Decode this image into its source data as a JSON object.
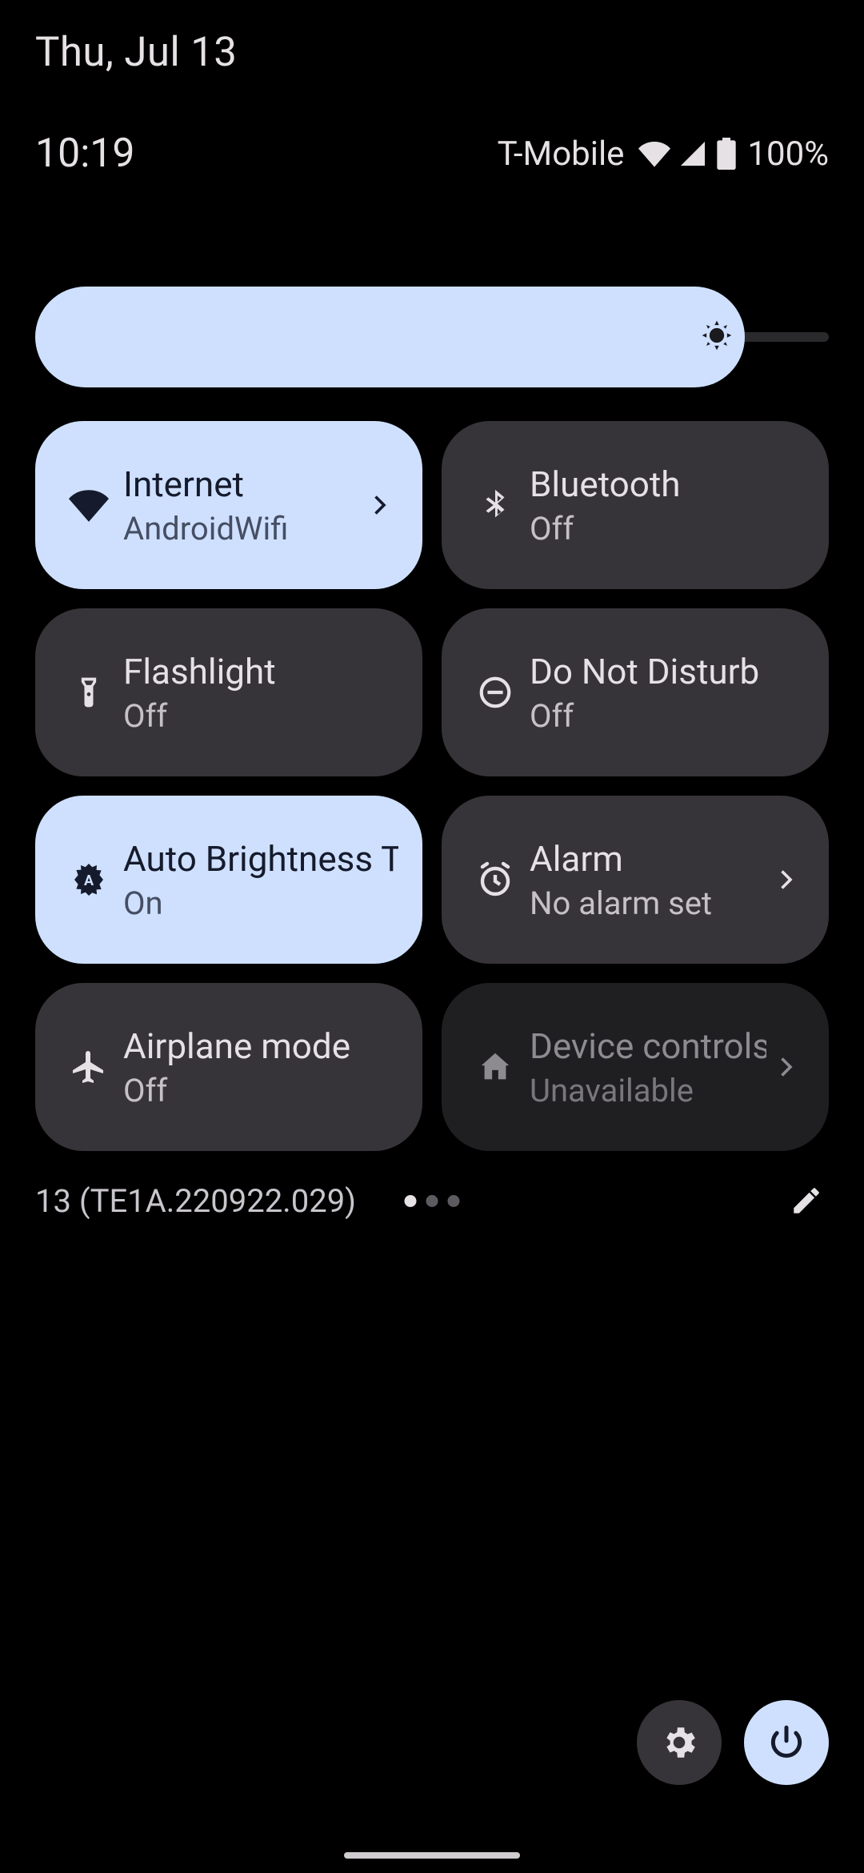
{
  "date": "Thu, Jul 13",
  "clock": "10:19",
  "carrier": "T-Mobile",
  "battery_pct": "100%",
  "build": "13 (TE1A.220922.029)",
  "brightness": {
    "percent": 89
  },
  "tiles": {
    "internet": {
      "title": "Internet",
      "sub": "AndroidWifi"
    },
    "bluetooth": {
      "title": "Bluetooth",
      "sub": "Off"
    },
    "flashlight": {
      "title": "Flashlight",
      "sub": "Off"
    },
    "dnd": {
      "title": "Do Not Disturb",
      "sub": "Off"
    },
    "autobright": {
      "title": "Auto Brightness Tile",
      "sub": "On"
    },
    "alarm": {
      "title": "Alarm",
      "sub": "No alarm set"
    },
    "airplane": {
      "title": "Airplane mode",
      "sub": "Off"
    },
    "devctrl": {
      "title": "Device controls",
      "sub": "Unavailable"
    }
  },
  "pages": {
    "count": 3,
    "active_index": 0
  }
}
